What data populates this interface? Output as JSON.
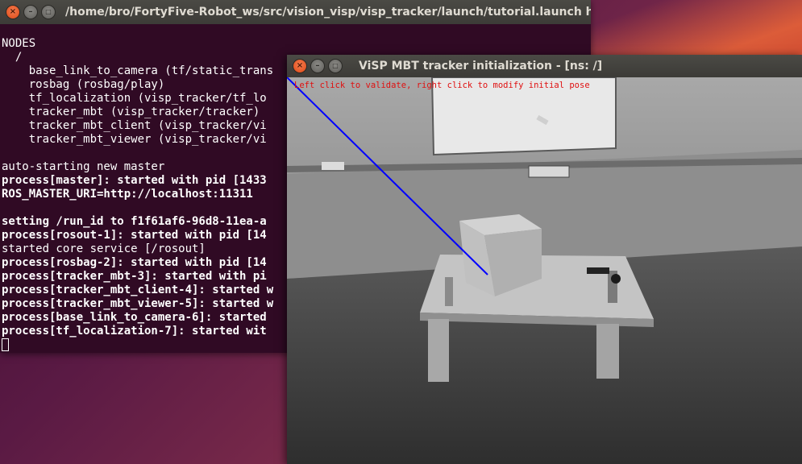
{
  "terminal": {
    "title": "/home/bro/FortyFive-Robot_ws/src/vision_visp/visp_tracker/launch/tutorial.launch http://",
    "lines": [
      {
        "text": "NODES",
        "bold": false
      },
      {
        "text": "  /",
        "bold": false
      },
      {
        "text": "    base_link_to_camera (tf/static_trans",
        "bold": false
      },
      {
        "text": "    rosbag (rosbag/play)",
        "bold": false
      },
      {
        "text": "    tf_localization (visp_tracker/tf_lo",
        "bold": false
      },
      {
        "text": "    tracker_mbt (visp_tracker/tracker)",
        "bold": false
      },
      {
        "text": "    tracker_mbt_client (visp_tracker/vi",
        "bold": false
      },
      {
        "text": "    tracker_mbt_viewer (visp_tracker/vi",
        "bold": false
      },
      {
        "text": "",
        "bold": false
      },
      {
        "text": "auto-starting new master",
        "bold": false
      },
      {
        "text": "process[master]: started with pid [1433",
        "bold": true
      },
      {
        "text": "ROS_MASTER_URI=http://localhost:11311",
        "bold": true
      },
      {
        "text": "",
        "bold": false
      },
      {
        "text": "setting /run_id to f1f61af6-96d8-11ea-a",
        "bold": true
      },
      {
        "text": "process[rosout-1]: started with pid [14",
        "bold": true
      },
      {
        "text": "started core service [/rosout]",
        "bold": false
      },
      {
        "text": "process[rosbag-2]: started with pid [14",
        "bold": true
      },
      {
        "text": "process[tracker_mbt-3]: started with pi",
        "bold": true
      },
      {
        "text": "process[tracker_mbt_client-4]: started w",
        "bold": true
      },
      {
        "text": "process[tracker_mbt_viewer-5]: started w",
        "bold": true
      },
      {
        "text": "process[base_link_to_camera-6]: started",
        "bold": true
      },
      {
        "text": "process[tf_localization-7]: started wit",
        "bold": true
      }
    ]
  },
  "visp_window": {
    "title": "ViSP MBT tracker initialization - [ns: /]",
    "hint": "Left click to validate, right click to modify initial pose",
    "line_color": "#0000ff",
    "hint_color": "#e01010"
  },
  "window_buttons": {
    "close": "×",
    "minimize": "–",
    "maximize": "□"
  }
}
